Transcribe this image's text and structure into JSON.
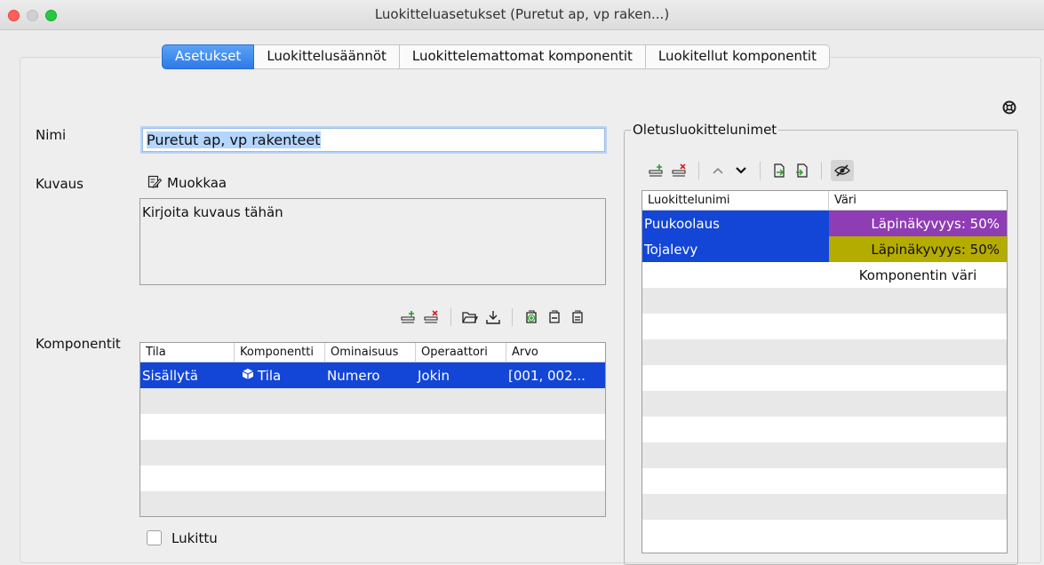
{
  "window": {
    "title": "Luokitteluasetukset (Puretut ap, vp raken...)"
  },
  "tabs": [
    {
      "label": "Asetukset",
      "active": true
    },
    {
      "label": "Luokittelusäännöt",
      "active": false
    },
    {
      "label": "Luokittelemattomat komponentit",
      "active": false
    },
    {
      "label": "Luokitellut komponentit",
      "active": false
    }
  ],
  "form": {
    "name_label": "Nimi",
    "name_value": "Puretut ap, vp rakenteet",
    "description_label": "Kuvaus",
    "edit_label": "Muokkaa",
    "description_value": "Kirjoita kuvaus tähän",
    "components_label": "Komponentit",
    "locked_label": "Lukittu"
  },
  "components_table": {
    "columns": [
      "Tila",
      "Komponentti",
      "Ominaisuus",
      "Operaattori",
      "Arvo"
    ],
    "rows": [
      {
        "tila": "Sisällytä",
        "komponentti": "Tila",
        "ominaisuus": "Numero",
        "operaattori": "Jokin",
        "arvo": "[001, 002..."
      }
    ]
  },
  "defaults": {
    "legend": "Oletusluokittelunimet",
    "columns": [
      "Luokittelunimi",
      "Väri"
    ],
    "rows": [
      {
        "name": "Puukoolaus",
        "color_text": "Läpinäkyvyys: 50%",
        "color": "#8e3db4"
      },
      {
        "name": "Tojalevy",
        "color_text": "Läpinäkyvyys: 50%",
        "color": "#b5ac00"
      },
      {
        "name": "",
        "color_text": "Komponentin väri",
        "color": "#ffffff"
      }
    ]
  },
  "colors": {
    "accent": "#2e79e8",
    "selection": "#1346d6"
  }
}
